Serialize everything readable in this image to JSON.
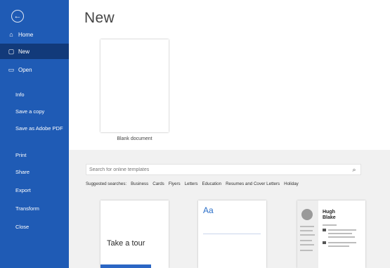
{
  "sidebar": {
    "back_icon": "back-arrow-icon",
    "nav": [
      {
        "id": "home",
        "label": "Home",
        "icon": "home-icon",
        "glyph": "⌂",
        "active": false
      },
      {
        "id": "new",
        "label": "New",
        "icon": "new-document-icon",
        "glyph": "▢",
        "active": true
      },
      {
        "id": "open",
        "label": "Open",
        "icon": "folder-open-icon",
        "glyph": "▭",
        "active": false
      }
    ],
    "menu": [
      {
        "id": "info",
        "label": "Info"
      },
      {
        "id": "save-a-copy",
        "label": "Save a copy"
      },
      {
        "id": "save-as-adobe-pdf",
        "label": "Save as Adobe PDF"
      },
      {
        "id": "print",
        "label": "Print"
      },
      {
        "id": "share",
        "label": "Share"
      },
      {
        "id": "export",
        "label": "Export"
      },
      {
        "id": "transform",
        "label": "Transform"
      },
      {
        "id": "close",
        "label": "Close"
      }
    ]
  },
  "main": {
    "title": "New",
    "blank_document_label": "Blank document",
    "search": {
      "placeholder": "Search for online templates"
    },
    "suggested": {
      "label": "Suggested searches:",
      "items": [
        "Business",
        "Cards",
        "Flyers",
        "Letters",
        "Education",
        "Resumes and Cover Letters",
        "Holiday"
      ]
    },
    "templates": [
      {
        "id": "tour",
        "text": "Take a tour"
      },
      {
        "id": "aa",
        "text": "Aa"
      },
      {
        "id": "resume",
        "name_line1": "Hugh",
        "name_line2": "Blake"
      }
    ]
  },
  "colors": {
    "sidebar": "#1f5bb5",
    "sidebar_active": "#123a7a",
    "accent": "#2b66c4"
  }
}
